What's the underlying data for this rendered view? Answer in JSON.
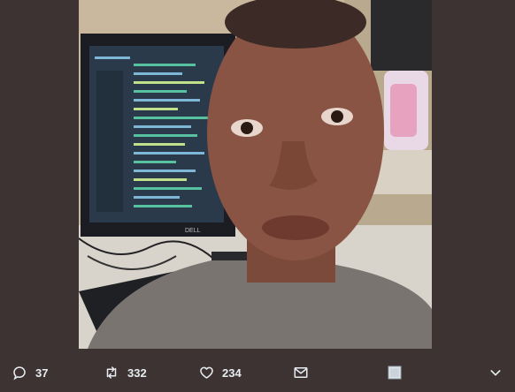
{
  "tweet_actions": {
    "reply": {
      "icon": "reply-icon",
      "count": "37"
    },
    "retweet": {
      "icon": "retweet-icon",
      "count": "332"
    },
    "like": {
      "icon": "heart-icon",
      "count": "234"
    },
    "dm": {
      "icon": "envelope-icon"
    },
    "media": {
      "icon": "image-icon"
    },
    "more": {
      "icon": "chevron-down-icon"
    }
  },
  "colors": {
    "background": "#3e3333",
    "icon": "#e6ecf0"
  },
  "photo": {
    "monitor_brand": "DELL"
  }
}
